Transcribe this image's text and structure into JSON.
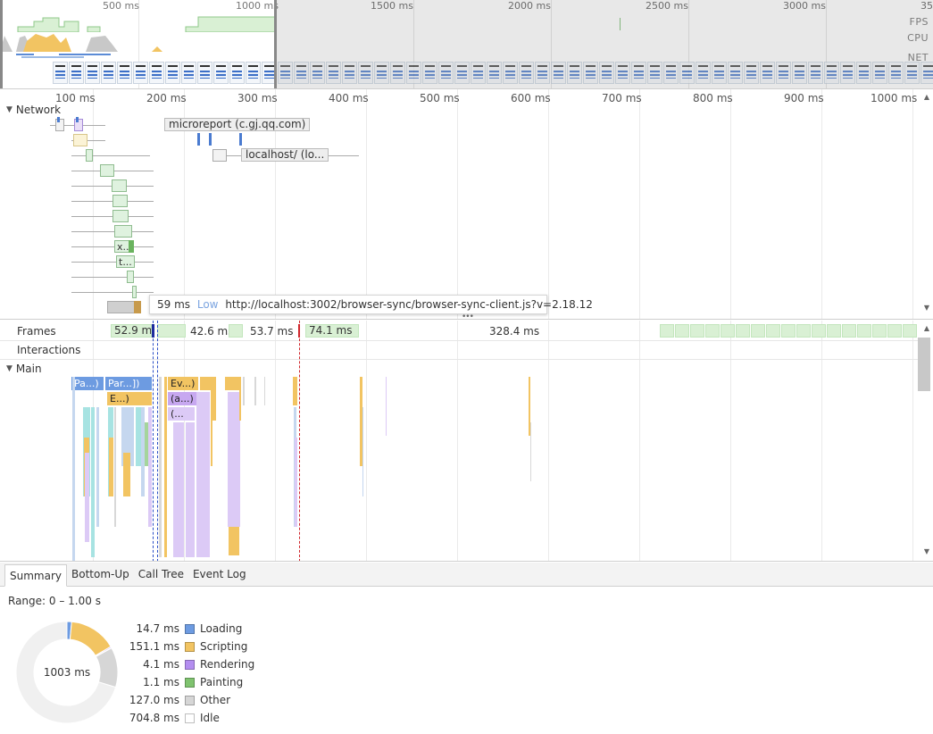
{
  "overview": {
    "ticks": [
      "500 ms",
      "1000 ms",
      "1500 ms",
      "2000 ms",
      "2500 ms",
      "3000 ms",
      "35"
    ],
    "labels": {
      "fps": "FPS",
      "cpu": "CPU",
      "net": "NET"
    }
  },
  "network": {
    "title": "Network",
    "ticks": [
      "100 ms",
      "200 ms",
      "300 ms",
      "400 ms",
      "500 ms",
      "600 ms",
      "700 ms",
      "800 ms",
      "900 ms",
      "1000 ms"
    ],
    "labels": {
      "microreport": "microreport (c.gj.qq.com)",
      "localhost": "localhost/ (lo...",
      "x": "x...",
      "t": "t..."
    },
    "tooltip": {
      "duration": "59 ms",
      "priority": "Low",
      "url": "http://localhost:3002/browser-sync/browser-sync-client.js?v=2.18.12"
    }
  },
  "timeline": {
    "frames_title": "Frames",
    "interactions_title": "Interactions",
    "main_title": "Main",
    "frames": [
      "52.9 ms",
      "42.6 ms",
      "53.7 ms",
      "74.1 ms",
      "328.4 ms"
    ],
    "flame_labels": {
      "pa": "Pa...)",
      "par": "Par...])",
      "ev": "Ev...)",
      "e": "E...)",
      "a": "(a...)",
      "paren": "(..."
    }
  },
  "tabs": [
    "Summary",
    "Bottom-Up",
    "Call Tree",
    "Event Log"
  ],
  "summary": {
    "range": "Range: 0 – 1.00 s",
    "total": "1003 ms",
    "legend": [
      {
        "value": "14.7 ms",
        "label": "Loading",
        "color": "#6d9be1",
        "ms": 14.7
      },
      {
        "value": "151.1 ms",
        "label": "Scripting",
        "color": "#f2c462",
        "ms": 151.1
      },
      {
        "value": "4.1 ms",
        "label": "Rendering",
        "color": "#b48ef0",
        "ms": 4.1
      },
      {
        "value": "1.1 ms",
        "label": "Painting",
        "color": "#7fc36f",
        "ms": 1.1
      },
      {
        "value": "127.0 ms",
        "label": "Other",
        "color": "#d6d6d6",
        "ms": 127.0
      },
      {
        "value": "704.8 ms",
        "label": "Idle",
        "color": "#ffffff",
        "ms": 704.8
      }
    ]
  }
}
